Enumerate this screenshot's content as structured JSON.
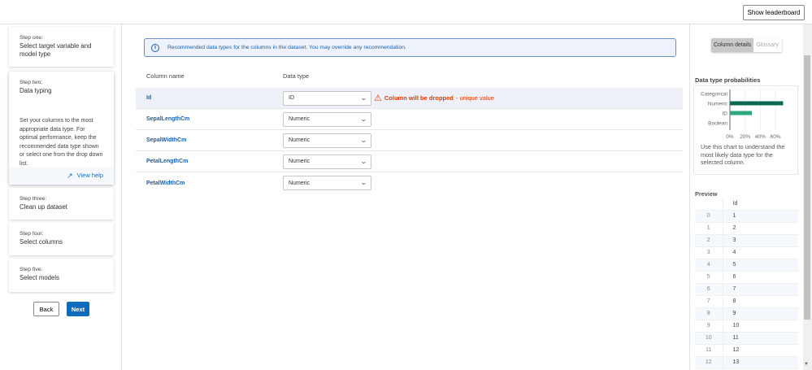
{
  "header": {
    "leaderboard_button": "Show leaderboard"
  },
  "steps": [
    {
      "label": "Step one:",
      "title": "Select target variable and model type"
    },
    {
      "label": "Step two:",
      "title": "Data typing",
      "description": "Set your columns to the most appropriate data type. For optimal performance, keep the recommended data type shown or select one from the drop down list.",
      "help_link": "View help"
    },
    {
      "label": "Step three:",
      "title": "Clean up dataset"
    },
    {
      "label": "Step four:",
      "title": "Select columns"
    },
    {
      "label": "Step five:",
      "title": "Select models"
    }
  ],
  "nav": {
    "back": "Back",
    "next": "Next"
  },
  "info_message": "Recommended data types for the columns in the dataset. You may override any recommendation.",
  "table": {
    "headers": {
      "name": "Column name",
      "type": "Data type"
    },
    "rows": [
      {
        "name": "Id",
        "type": "ID",
        "warning": "Column will be dropped",
        "warning_detail": " - unique value"
      },
      {
        "name": "SepalLengthCm",
        "type": "Numeric"
      },
      {
        "name": "SepalWidthCm",
        "type": "Numeric"
      },
      {
        "name": "PetalLengthCm",
        "type": "Numeric"
      },
      {
        "name": "PetalWidthCm",
        "type": "Numeric"
      }
    ]
  },
  "right_panel": {
    "tabs": [
      "Column details",
      "Glossary"
    ],
    "chart_title": "Data type probabilities",
    "chart_note": "Use this chart to understand the most likely data type for the selected column.",
    "preview_title": "Preview",
    "preview_header": "Id",
    "preview_rows": [
      [
        "0",
        "1"
      ],
      [
        "1",
        "2"
      ],
      [
        "2",
        "3"
      ],
      [
        "3",
        "4"
      ],
      [
        "4",
        "5"
      ],
      [
        "5",
        "6"
      ],
      [
        "6",
        "7"
      ],
      [
        "7",
        "8"
      ],
      [
        "8",
        "9"
      ],
      [
        "9",
        "10"
      ],
      [
        "10",
        "11"
      ],
      [
        "11",
        "12"
      ],
      [
        "12",
        "13"
      ]
    ]
  },
  "chart_data": {
    "type": "bar",
    "orientation": "horizontal",
    "categories": [
      "Categorical",
      "Numeric",
      "ID",
      "Boolean"
    ],
    "values": [
      0,
      70,
      29,
      0
    ],
    "xticks": [
      "0%",
      "20%",
      "40%",
      "60%"
    ],
    "xlim": [
      0,
      75
    ],
    "colors": {
      "Numeric": "#0b6a4f",
      "ID": "#2fa57e"
    }
  }
}
